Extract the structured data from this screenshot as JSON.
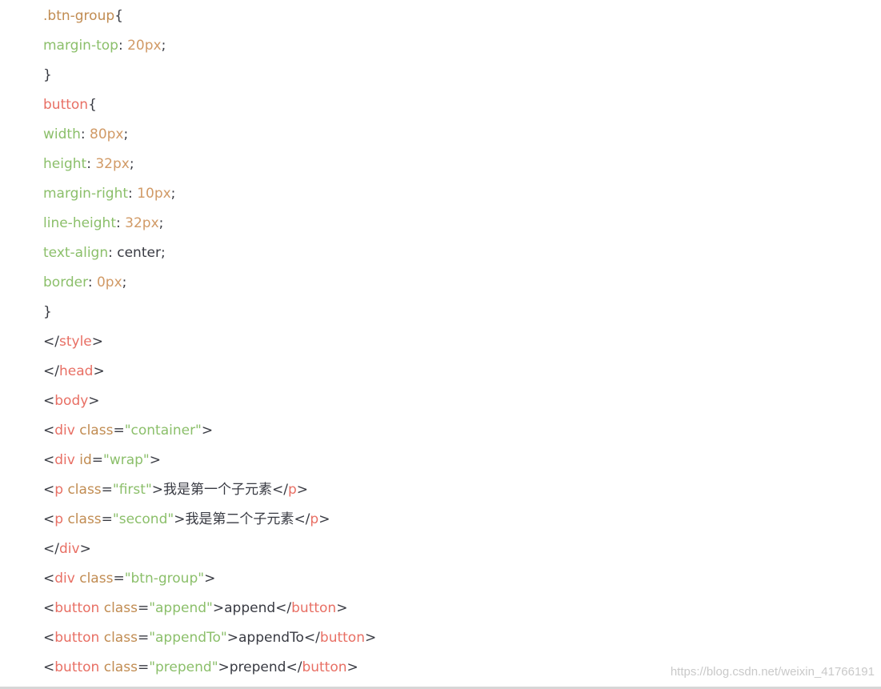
{
  "code_lines": [
    [
      {
        "t": ".btn-group",
        "c": "selector"
      },
      {
        "t": "{",
        "c": "punct"
      }
    ],
    [
      {
        "t": "margin-top",
        "c": "prop"
      },
      {
        "t": ": ",
        "c": "punct"
      },
      {
        "t": "20px",
        "c": "number"
      },
      {
        "t": ";",
        "c": "punct"
      }
    ],
    [
      {
        "t": "}",
        "c": "punct"
      }
    ],
    [
      {
        "t": "button",
        "c": "tag"
      },
      {
        "t": "{",
        "c": "punct"
      }
    ],
    [
      {
        "t": "width",
        "c": "prop"
      },
      {
        "t": ": ",
        "c": "punct"
      },
      {
        "t": "80px",
        "c": "number"
      },
      {
        "t": ";",
        "c": "punct"
      }
    ],
    [
      {
        "t": "height",
        "c": "prop"
      },
      {
        "t": ": ",
        "c": "punct"
      },
      {
        "t": "32px",
        "c": "number"
      },
      {
        "t": ";",
        "c": "punct"
      }
    ],
    [
      {
        "t": "margin-right",
        "c": "prop"
      },
      {
        "t": ": ",
        "c": "punct"
      },
      {
        "t": "10px",
        "c": "number"
      },
      {
        "t": ";",
        "c": "punct"
      }
    ],
    [
      {
        "t": "line-height",
        "c": "prop"
      },
      {
        "t": ": ",
        "c": "punct"
      },
      {
        "t": "32px",
        "c": "number"
      },
      {
        "t": ";",
        "c": "punct"
      }
    ],
    [
      {
        "t": "text-align",
        "c": "prop"
      },
      {
        "t": ": center;",
        "c": "punct"
      }
    ],
    [
      {
        "t": "border",
        "c": "prop"
      },
      {
        "t": ": ",
        "c": "punct"
      },
      {
        "t": "0px",
        "c": "number"
      },
      {
        "t": ";",
        "c": "punct"
      }
    ],
    [
      {
        "t": "}",
        "c": "punct"
      }
    ],
    [
      {
        "t": "</",
        "c": "punct"
      },
      {
        "t": "style",
        "c": "tag"
      },
      {
        "t": ">",
        "c": "punct"
      }
    ],
    [
      {
        "t": "</",
        "c": "punct"
      },
      {
        "t": "head",
        "c": "tag"
      },
      {
        "t": ">",
        "c": "punct"
      }
    ],
    [
      {
        "t": "<",
        "c": "punct"
      },
      {
        "t": "body",
        "c": "tag"
      },
      {
        "t": ">",
        "c": "punct"
      }
    ],
    [
      {
        "t": "<",
        "c": "punct"
      },
      {
        "t": "div",
        "c": "tag"
      },
      {
        "t": " ",
        "c": "punct"
      },
      {
        "t": "class",
        "c": "attr"
      },
      {
        "t": "=",
        "c": "punct"
      },
      {
        "t": "\"container\"",
        "c": "string"
      },
      {
        "t": ">",
        "c": "punct"
      }
    ],
    [
      {
        "t": "<",
        "c": "punct"
      },
      {
        "t": "div",
        "c": "tag"
      },
      {
        "t": " ",
        "c": "punct"
      },
      {
        "t": "id",
        "c": "attr"
      },
      {
        "t": "=",
        "c": "punct"
      },
      {
        "t": "\"wrap\"",
        "c": "string"
      },
      {
        "t": ">",
        "c": "punct"
      }
    ],
    [
      {
        "t": "<",
        "c": "punct"
      },
      {
        "t": "p",
        "c": "tag"
      },
      {
        "t": " ",
        "c": "punct"
      },
      {
        "t": "class",
        "c": "attr"
      },
      {
        "t": "=",
        "c": "punct"
      },
      {
        "t": "\"first\"",
        "c": "string"
      },
      {
        "t": ">",
        "c": "punct"
      },
      {
        "t": "我是第一个子元素",
        "c": "text"
      },
      {
        "t": "</",
        "c": "punct"
      },
      {
        "t": "p",
        "c": "tag"
      },
      {
        "t": ">",
        "c": "punct"
      }
    ],
    [
      {
        "t": "<",
        "c": "punct"
      },
      {
        "t": "p",
        "c": "tag"
      },
      {
        "t": " ",
        "c": "punct"
      },
      {
        "t": "class",
        "c": "attr"
      },
      {
        "t": "=",
        "c": "punct"
      },
      {
        "t": "\"second\"",
        "c": "string"
      },
      {
        "t": ">",
        "c": "punct"
      },
      {
        "t": "我是第二个子元素",
        "c": "text"
      },
      {
        "t": "</",
        "c": "punct"
      },
      {
        "t": "p",
        "c": "tag"
      },
      {
        "t": ">",
        "c": "punct"
      }
    ],
    [
      {
        "t": "</",
        "c": "punct"
      },
      {
        "t": "div",
        "c": "tag"
      },
      {
        "t": ">",
        "c": "punct"
      }
    ],
    [
      {
        "t": "<",
        "c": "punct"
      },
      {
        "t": "div",
        "c": "tag"
      },
      {
        "t": " ",
        "c": "punct"
      },
      {
        "t": "class",
        "c": "attr"
      },
      {
        "t": "=",
        "c": "punct"
      },
      {
        "t": "\"btn-group\"",
        "c": "string"
      },
      {
        "t": ">",
        "c": "punct"
      }
    ],
    [
      {
        "t": "<",
        "c": "punct"
      },
      {
        "t": "button",
        "c": "tag"
      },
      {
        "t": " ",
        "c": "punct"
      },
      {
        "t": "class",
        "c": "attr"
      },
      {
        "t": "=",
        "c": "punct"
      },
      {
        "t": "\"append\"",
        "c": "string"
      },
      {
        "t": ">",
        "c": "punct"
      },
      {
        "t": "append",
        "c": "text"
      },
      {
        "t": "</",
        "c": "punct"
      },
      {
        "t": "button",
        "c": "tag"
      },
      {
        "t": ">",
        "c": "punct"
      }
    ],
    [
      {
        "t": "<",
        "c": "punct"
      },
      {
        "t": "button",
        "c": "tag"
      },
      {
        "t": " ",
        "c": "punct"
      },
      {
        "t": "class",
        "c": "attr"
      },
      {
        "t": "=",
        "c": "punct"
      },
      {
        "t": "\"appendTo\"",
        "c": "string"
      },
      {
        "t": ">",
        "c": "punct"
      },
      {
        "t": "appendTo",
        "c": "text"
      },
      {
        "t": "</",
        "c": "punct"
      },
      {
        "t": "button",
        "c": "tag"
      },
      {
        "t": ">",
        "c": "punct"
      }
    ],
    [
      {
        "t": "<",
        "c": "punct"
      },
      {
        "t": "button",
        "c": "tag"
      },
      {
        "t": " ",
        "c": "punct"
      },
      {
        "t": "class",
        "c": "attr"
      },
      {
        "t": "=",
        "c": "punct"
      },
      {
        "t": "\"prepend\"",
        "c": "string"
      },
      {
        "t": ">",
        "c": "punct"
      },
      {
        "t": "prepend",
        "c": "text"
      },
      {
        "t": "</",
        "c": "punct"
      },
      {
        "t": "button",
        "c": "tag"
      },
      {
        "t": ">",
        "c": "punct"
      }
    ]
  ],
  "watermark": "https://blog.csdn.net/weixin_41766191",
  "colors": {
    "selector": "#c18c52",
    "property": "#8bbf6a",
    "number": "#d19a66",
    "tag": "#e45649",
    "attribute": "#c18c52",
    "string": "#8bbf6a",
    "text": "#383a42",
    "background": "#ffffff"
  }
}
